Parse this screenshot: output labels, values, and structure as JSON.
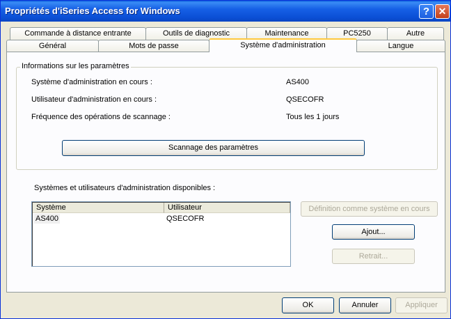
{
  "window": {
    "title": "Propriétés d'iSeries Access for Windows",
    "help_label": "?",
    "close_label": "✕"
  },
  "tabs_row1": [
    {
      "label": "Commande à distance entrante"
    },
    {
      "label": "Outils de diagnostic"
    },
    {
      "label": "Maintenance"
    },
    {
      "label": "PC5250"
    },
    {
      "label": "Autre"
    }
  ],
  "tabs_row2": [
    {
      "label": "Général"
    },
    {
      "label": "Mots de passe"
    },
    {
      "label": "Système d'administration",
      "active": true
    },
    {
      "label": "Langue"
    }
  ],
  "settings_group": {
    "legend": "Informations sur les paramètres",
    "rows": [
      {
        "label": "Système d'administration en cours :",
        "value": "AS400"
      },
      {
        "label": "Utilisateur d'administration en cours :",
        "value": "QSECOFR"
      },
      {
        "label": "Fréquence des opérations de scannage :",
        "value": "Tous les 1 jours"
      }
    ],
    "scan_button": "Scannage des paramètres"
  },
  "available": {
    "label": "Systèmes et utilisateurs d'administration disponibles :",
    "columns": [
      "Système",
      "Utilisateur"
    ],
    "rows": [
      {
        "system": "AS400",
        "user": "QSECOFR"
      }
    ],
    "set_current_button": "Définition comme système en cours",
    "add_button": "Ajout...",
    "remove_button": "Retrait..."
  },
  "footer": {
    "ok": "OK",
    "cancel": "Annuler",
    "apply": "Appliquer"
  }
}
